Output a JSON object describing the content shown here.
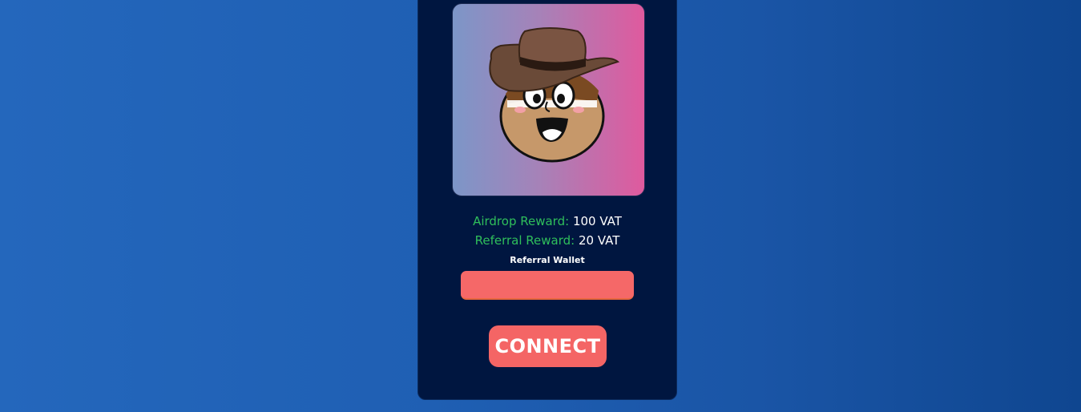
{
  "card": {
    "avatar": {
      "icon": "cowboy-hat-character-avatar"
    },
    "airdrop": {
      "label": "Airdrop Reward:",
      "value": "100 VAT"
    },
    "referral": {
      "label": "Referral Reward:",
      "value": "20 VAT"
    },
    "wallet": {
      "label": "Referral Wallet",
      "value": "",
      "placeholder": ""
    },
    "connect_label": "CONNECT"
  },
  "colors": {
    "card_bg": "#001640",
    "accent_green": "#2fbf5b",
    "button": "#f46565",
    "page_gradient_start": "#2467bc",
    "page_gradient_end": "#0f4690"
  }
}
